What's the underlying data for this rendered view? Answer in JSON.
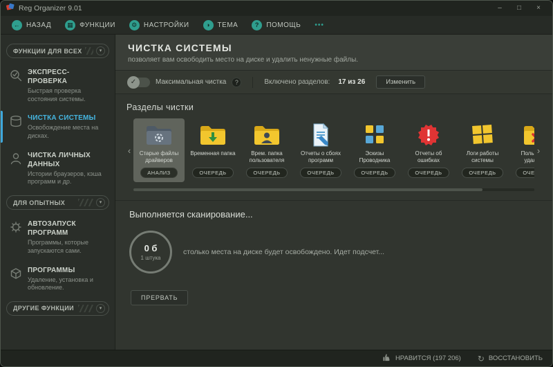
{
  "window": {
    "title": "Reg Organizer 9.01"
  },
  "icons": {
    "minimize": "–",
    "maximize": "□",
    "close": "×",
    "back": "←",
    "functions": "▦",
    "settings": "⚙",
    "theme": "◑",
    "help": "?",
    "more": "•••",
    "chevron": "▾",
    "arrow_left": "‹",
    "arrow_right": "›",
    "help_badge": "?",
    "check": "✓",
    "restore": "↻"
  },
  "menu": {
    "back": "НАЗАД",
    "functions": "ФУНКЦИИ",
    "settings": "НАСТРОЙКИ",
    "theme": "ТЕМА",
    "help": "ПОМОЩЬ"
  },
  "sidebar": {
    "section_all": "ФУНКЦИИ ДЛЯ ВСЕХ",
    "section_advanced": "ДЛЯ ОПЫТНЫХ",
    "section_other": "ДРУГИЕ ФУНКЦИИ",
    "items": [
      {
        "title": "ЭКСПРЕСС-ПРОВЕРКА",
        "desc": "Быстрая проверка состояния системы."
      },
      {
        "title": "ЧИСТКА СИСТЕМЫ",
        "desc": "Освобождение места на дисках."
      },
      {
        "title": "ЧИСТКА ЛИЧНЫХ ДАННЫХ",
        "desc": "Истории браузеров, кэша программ и др."
      },
      {
        "title": "АВТОЗАПУСК ПРОГРАММ",
        "desc": "Программы, которые запускаются сами."
      },
      {
        "title": "ПРОГРАММЫ",
        "desc": "Удаление, установка и обновление."
      }
    ]
  },
  "main": {
    "title": "ЧИСТКА СИСТЕМЫ",
    "subtitle": "позволяет вам освободить место на диске и удалить ненужные файлы.",
    "max_clean_label": "Максимальная чистка",
    "enabled_label": "Включено разделов:",
    "enabled_value": "17 из 26",
    "change_button": "Изменить",
    "sections_title": "Разделы чистки",
    "cards": [
      {
        "title": "Старые файлы драйверов",
        "status": "АНАЛИЗ"
      },
      {
        "title": "Временная папка",
        "status": "ОЧЕРЕДЬ"
      },
      {
        "title": "Врем. папка пользователя",
        "status": "ОЧЕРЕДЬ"
      },
      {
        "title": "Отчеты о сбоях программ",
        "status": "ОЧЕРЕДЬ"
      },
      {
        "title": "Эскизы Проводника",
        "status": "ОЧЕРЕДЬ"
      },
      {
        "title": "Отчеты об ошибках",
        "status": "ОЧЕРЕДЬ"
      },
      {
        "title": "Логи работы системы",
        "status": "ОЧЕРЕДЬ"
      },
      {
        "title": "Польз. фай. удаления",
        "status": "ОЧЕРЕДЬ"
      }
    ],
    "scan": {
      "title": "Выполняется сканирование...",
      "size_value": "0 б",
      "count_value": "1 штука",
      "description": "столько места на диске будет освобождено. Идет подсчет...",
      "abort_button": "ПРЕРВАТЬ"
    }
  },
  "statusbar": {
    "like_label": "НРАВИТСЯ (197 206)",
    "restore_label": "ВОССТАНОВИТЬ"
  },
  "colors": {
    "accent_teal": "#2f9e8e",
    "active_cyan": "#45b5e0",
    "folder_yellow": "#f2c62e",
    "alert_red": "#e03434"
  }
}
